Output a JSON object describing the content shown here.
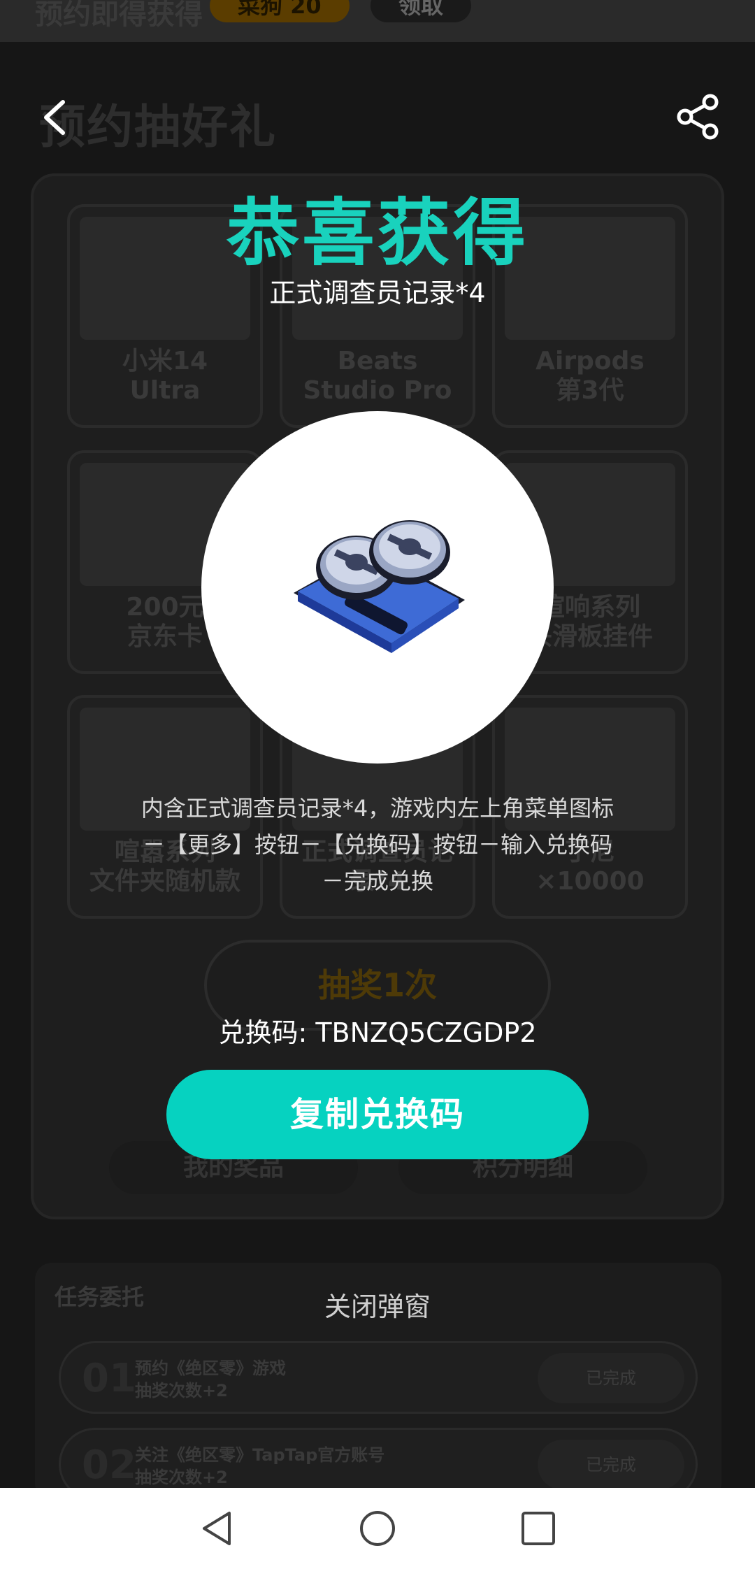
{
  "background": {
    "top_strip": {
      "text": "预约即得获得",
      "pill1": "菜狗 20",
      "pill2": "领取"
    },
    "page_title": "预约抽好礼",
    "prizes": [
      {
        "label": "小米14\nUltra"
      },
      {
        "label": "Beats\nStudio Pro"
      },
      {
        "label": "Airpods\n第3代"
      },
      {
        "label": "200元\n京东卡"
      },
      {
        "label": ""
      },
      {
        "label": "喧响系列\n头滑板挂件"
      },
      {
        "label": "喧嚣系列\n文件夹随机款"
      },
      {
        "label": "正式调查员记\n录*4"
      },
      {
        "label": "丁尼\n×10000"
      }
    ],
    "draw_button": "抽奖1次",
    "my_prizes_button": "我的奖品",
    "points_button": "积分明细",
    "tasks": {
      "header": "任务委托",
      "items": [
        {
          "num": "01",
          "desc": "预约《绝区零》游戏\n抽奖次数+2",
          "button": "已完成"
        },
        {
          "num": "02",
          "desc": "关注《绝区零》TapTap官方账号\n抽奖次数+2",
          "button": "已完成"
        }
      ]
    }
  },
  "modal": {
    "title": "恭喜获得",
    "subtitle": "正式调查员记录*4",
    "reward_icon": "investigator-record-tape-icon",
    "description": "内含正式调查员记录*4，游戏内左上角菜单图标－【更多】按钮－【兑换码】按钮－输入兑换码－完成兑换",
    "code_text": "兑换码: TBNZQ5CZGDP2",
    "copy_button": "复制兑换码",
    "close_text": "关闭弹窗"
  },
  "icons": {
    "back": "chevron-left-icon",
    "share": "share-icon",
    "nav_back": "triangle-back-icon",
    "nav_home": "circle-home-icon",
    "nav_recent": "square-recent-icon"
  },
  "colors": {
    "accent": "#19d2bd",
    "button": "#06d2c0"
  }
}
